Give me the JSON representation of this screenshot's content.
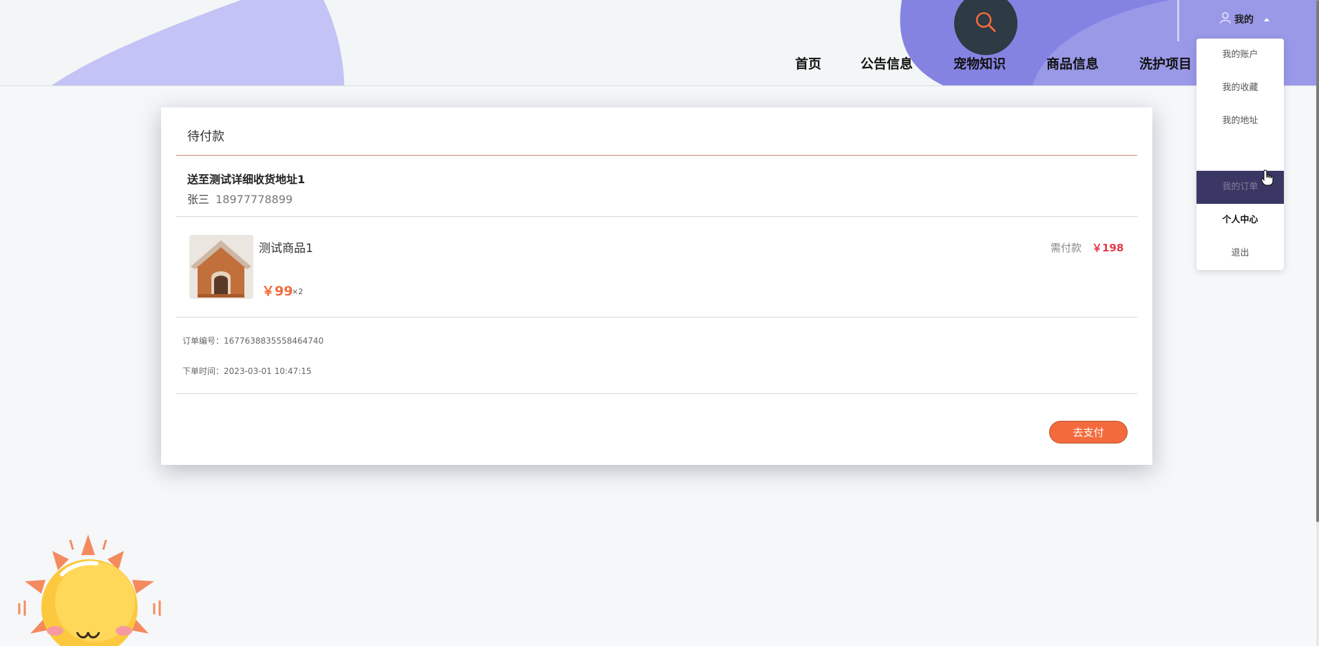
{
  "colors": {
    "accent": "#f36b3d",
    "price_red": "#e23a4a",
    "header_purple": "#7f7ee0",
    "dropdown_active": "#3a3764"
  },
  "header": {
    "search_icon": "search-icon",
    "user_icon": "user-icon",
    "user_label": "我的",
    "nav": [
      {
        "label": "首页"
      },
      {
        "label": "公告信息"
      },
      {
        "label": "宠物知识"
      },
      {
        "label": "商品信息"
      },
      {
        "label": "洗护项目"
      }
    ]
  },
  "dropdown": {
    "items": [
      {
        "label": "我的账户"
      },
      {
        "label": "我的收藏"
      },
      {
        "label": "我的地址"
      },
      {
        "label": ""
      },
      {
        "label": "我的订单"
      },
      {
        "label": "个人中心"
      },
      {
        "label": "退出"
      }
    ]
  },
  "order": {
    "status_title": "待付款",
    "address": "送至测试详细收货地址1",
    "receiver_name": "张三",
    "receiver_phone": "18977778899",
    "product": {
      "name": "测试商品1",
      "price": "￥99",
      "quantity": "×2",
      "image_icon": "pet-house-image"
    },
    "need_pay_label": "需付款",
    "need_pay_value": "￥198",
    "order_no_label": "订单编号：",
    "order_no": "1677638835558464740",
    "order_time_label": "下单时间：",
    "order_time": "2023-03-01 10:47:15",
    "pay_button": "去支付"
  }
}
